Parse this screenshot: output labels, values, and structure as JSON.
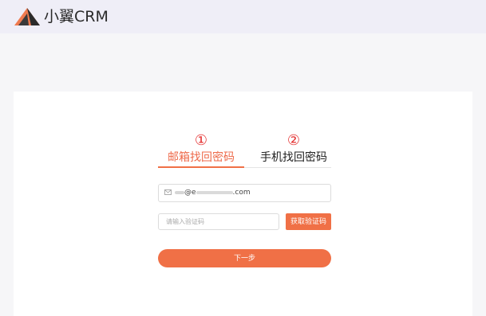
{
  "header": {
    "brand": "小翼CRM",
    "logo_icon": "triangle-logo-icon",
    "accent": "#f07046"
  },
  "steps": [
    {
      "num": "①",
      "label": "邮箱找回密码",
      "active": true
    },
    {
      "num": "②",
      "label": "手机找回密码",
      "active": false
    }
  ],
  "form": {
    "email_prefix": "",
    "email_mid": "@e",
    "email_suffix": ".com",
    "mail_icon": "mail-icon",
    "code_placeholder": "请输入验证码",
    "get_code_label": "获取验证码",
    "next_label": "下一步"
  }
}
